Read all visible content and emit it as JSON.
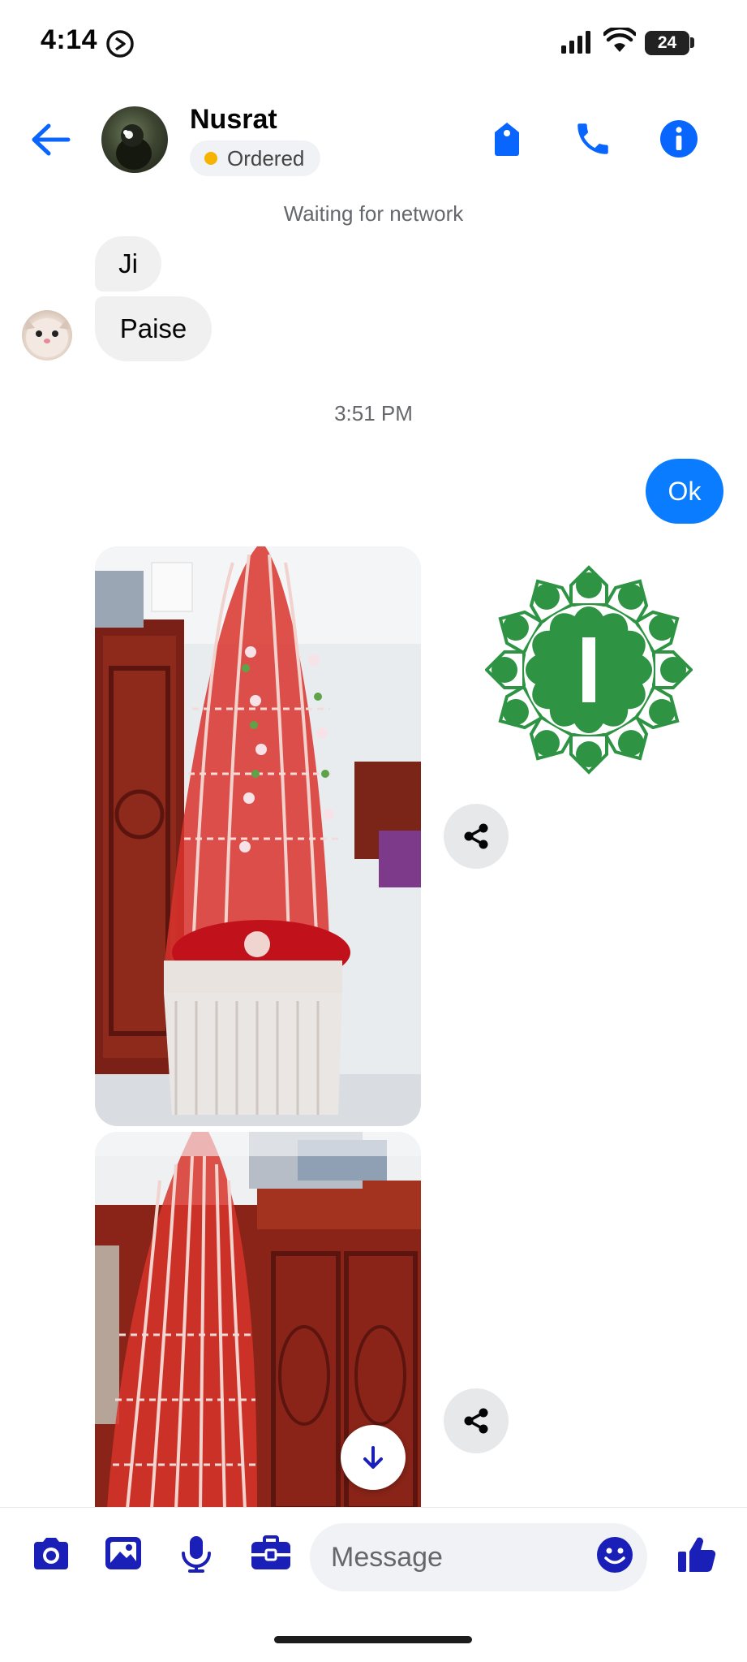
{
  "status_bar": {
    "time": "4:14",
    "battery": "24"
  },
  "header": {
    "contact_name": "Nusrat",
    "order_status": "Ordered"
  },
  "conversation": {
    "network_status": "Waiting for network",
    "incoming": [
      {
        "text": "Ji"
      },
      {
        "text": "Paise"
      }
    ],
    "timestamp": "3:51 PM",
    "outgoing": [
      {
        "text": "Ok"
      }
    ]
  },
  "composer": {
    "placeholder": "Message"
  },
  "colors": {
    "accent": "#0a7cff",
    "icon_blue": "#0866ff",
    "composer_icon": "#1a1fb8",
    "order_dot": "#f5b400",
    "sticker_green": "#2e9444"
  },
  "icons": [
    "back-arrow-icon",
    "tag-icon",
    "phone-icon",
    "info-icon",
    "share-icon",
    "arrow-down-icon",
    "camera-icon",
    "gallery-icon",
    "microphone-icon",
    "briefcase-icon",
    "emoji-icon",
    "thumbs-up-icon"
  ]
}
